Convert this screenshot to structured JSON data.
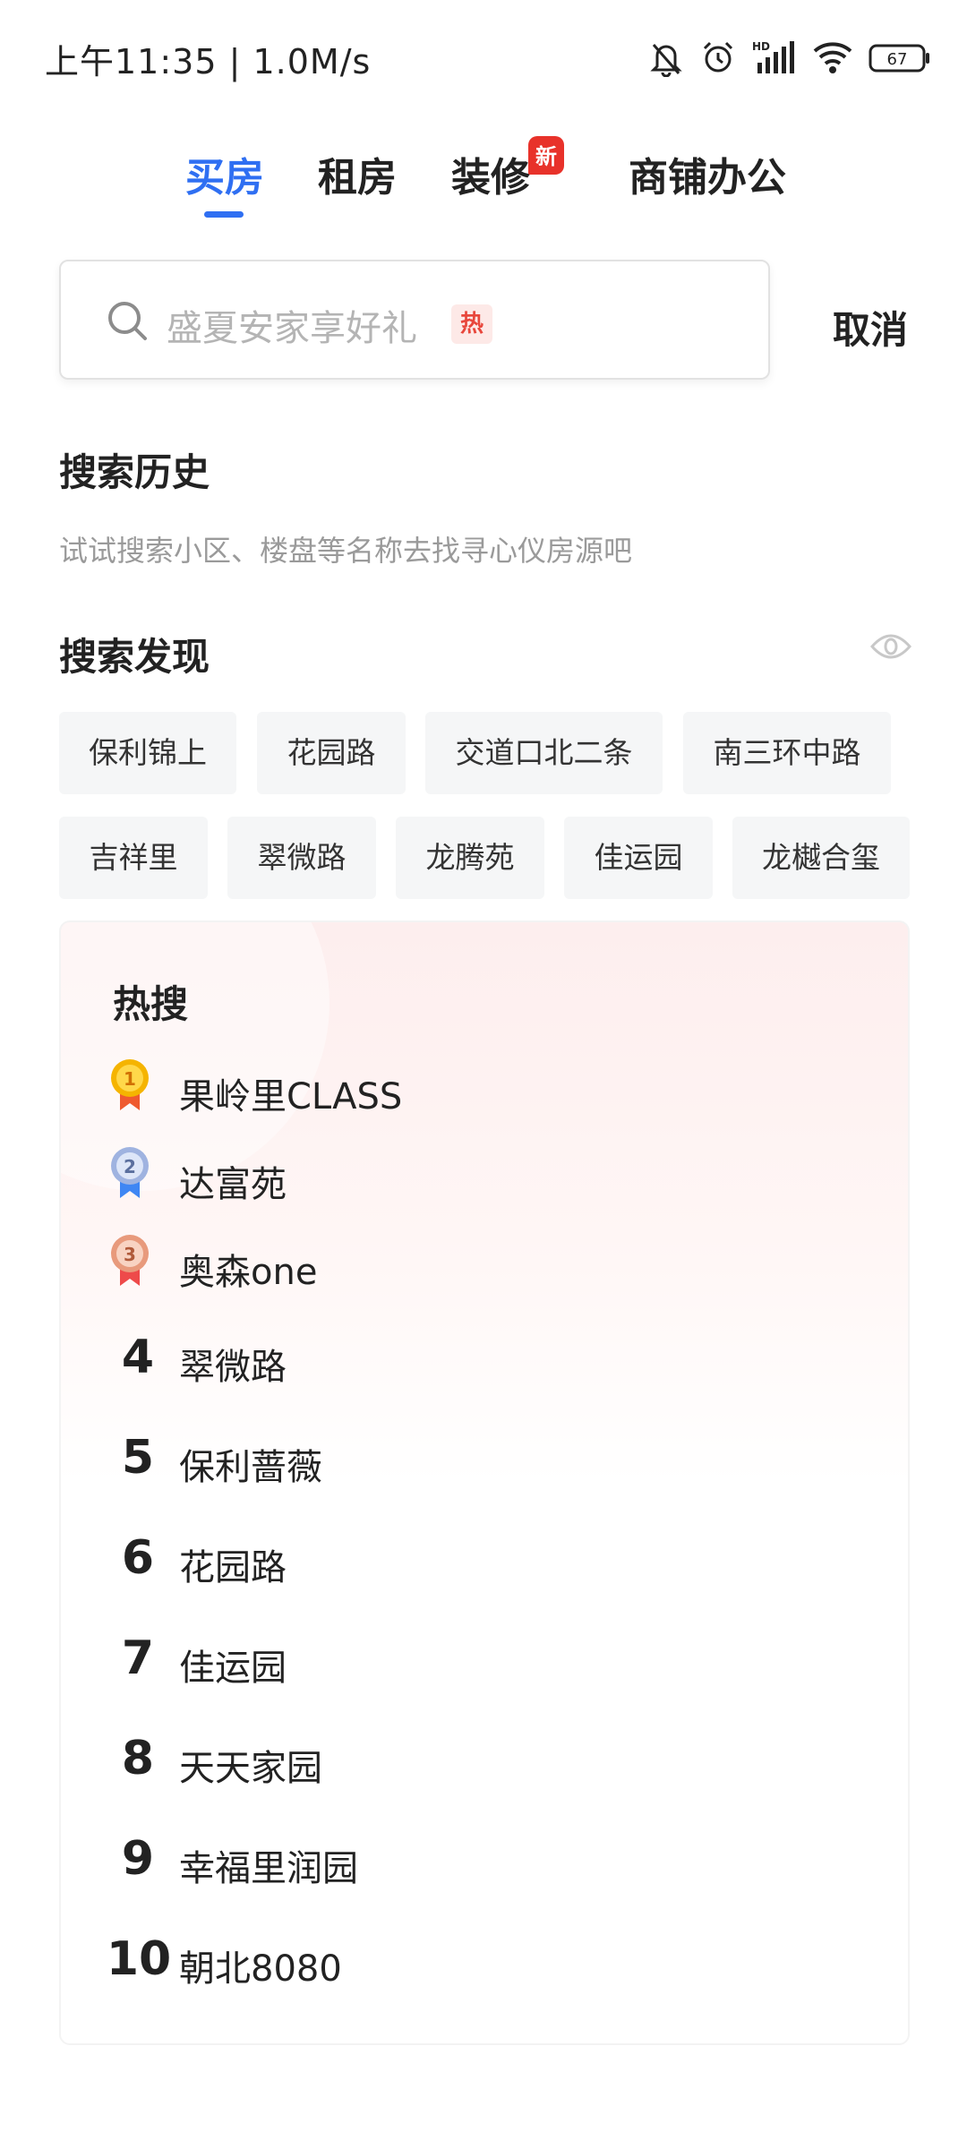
{
  "status_bar": {
    "time_speed": "上午11:35 | 1.0M/s",
    "icons": [
      "mute-bell-icon",
      "alarm-icon",
      "hd-signal-icon",
      "wifi-icon",
      "battery-icon"
    ],
    "battery": "67"
  },
  "tabs": [
    {
      "label": "买房",
      "active": true
    },
    {
      "label": "租房",
      "active": false
    },
    {
      "label": "装修",
      "active": false,
      "badge": "新"
    },
    {
      "label": "商铺办公",
      "active": false
    }
  ],
  "search": {
    "placeholder": "盛夏安家享好礼",
    "hot_tag": "热",
    "cancel_label": "取消"
  },
  "history": {
    "title": "搜索历史",
    "hint": "试试搜索小区、楼盘等名称去找寻心仪房源吧"
  },
  "discover": {
    "title": "搜索发现",
    "chips": [
      "保利锦上",
      "花园路",
      "交道口北二条",
      "南三环中路",
      "吉祥里",
      "翠微路",
      "龙腾苑",
      "佳运园",
      "龙樾合玺"
    ]
  },
  "hot": {
    "title": "热搜",
    "items": [
      {
        "rank": "1",
        "name": "果岭里CLASS"
      },
      {
        "rank": "2",
        "name": "达富苑"
      },
      {
        "rank": "3",
        "name": "奥森one"
      },
      {
        "rank": "4",
        "name": "翠微路"
      },
      {
        "rank": "5",
        "name": "保利蔷薇"
      },
      {
        "rank": "6",
        "name": "花园路"
      },
      {
        "rank": "7",
        "name": "佳运园"
      },
      {
        "rank": "8",
        "name": "天天家园"
      },
      {
        "rank": "9",
        "name": "幸福里润园"
      },
      {
        "rank": "10",
        "name": "朝北8080"
      }
    ]
  },
  "colors": {
    "accent": "#2f6ff2",
    "badge_red": "#e8322a",
    "gold": "#f5b400",
    "silver": "#9fb3e0",
    "bronze": "#e89a7c"
  }
}
